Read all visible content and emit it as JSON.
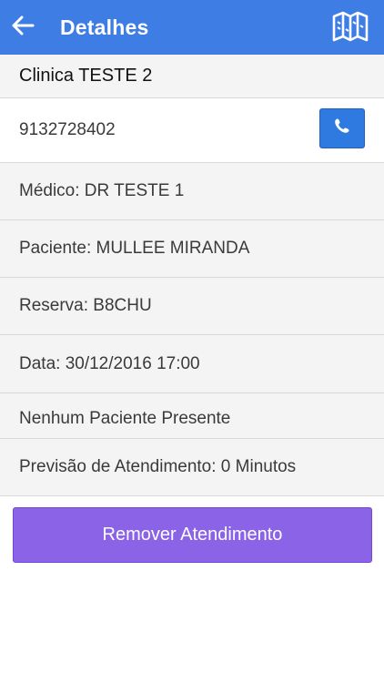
{
  "header": {
    "title": "Detalhes",
    "back_icon": "back-arrow-icon",
    "map_icon": "map-icon",
    "background": "#3d7de4"
  },
  "details": {
    "clinic": "Clinica TESTE 2",
    "phone": "9132728402",
    "phone_icon": "phone-icon",
    "doctor": "Médico: DR TESTE 1",
    "patient": "Paciente: MULLEE MIRANDA",
    "reservation": "Reserva: B8CHU",
    "date": "Data: 30/12/2016 17:00",
    "presence": "Nenhum Paciente Presente",
    "forecast": "Previsão de Atendimento: 0 Minutos"
  },
  "actions": {
    "remove_label": "Remover Atendimento",
    "remove_color": "#8b63e6",
    "call_color": "#2f7ae0"
  }
}
